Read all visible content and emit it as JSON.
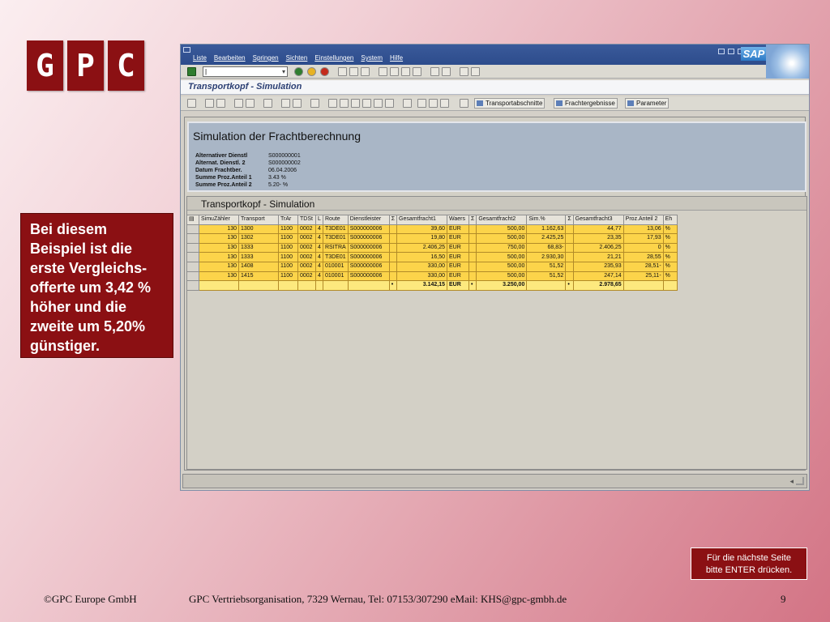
{
  "logo": {
    "letters": [
      "G",
      "P",
      "C"
    ]
  },
  "callout": "Bei diesem Beispiel ist die erste Vergleichs-offerte um 3,42 % höher und die zweite um 5,20% günstiger.",
  "enter_hint": [
    "Für die nächste Seite",
    "bitte ENTER drücken."
  ],
  "footer": {
    "copyright": "©GPC Europe GmbH",
    "contact": "GPC Vertriebsorganisation, 7329 Wernau, Tel: 07153/307290   eMail: KHS@gpc-gmbh.de",
    "page": "9"
  },
  "sap": {
    "menu": [
      "Liste",
      "Bearbeiten",
      "Springen",
      "Sichten",
      "Einstellungen",
      "System",
      "Hilfe"
    ],
    "logo": "SAP",
    "title": "Transportkopf - Simulation",
    "toolbar_buttons": [
      "Transportabschnitte",
      "Frachtergebnisse",
      "Parameter"
    ],
    "header_panel": {
      "title": "Simulation der Frachtberechnung",
      "rows": [
        {
          "label": "Alternativer Dienstl",
          "value": "S000000001"
        },
        {
          "label": "Alternat. Dienstl. 2",
          "value": "S000000002"
        },
        {
          "label": "Datum Frachtber.",
          "value": "06.04.2006"
        },
        {
          "label": "Summe Proz.Anteil 1",
          "value": "3.43 %"
        },
        {
          "label": "Summe Proz.Anteil 2",
          "value": "5.20- %"
        }
      ]
    },
    "list_title": "Transportkopf - Simulation",
    "columns": [
      "SimuZähler",
      "Transport",
      "TrAr",
      "TDSt",
      "L",
      "Route",
      "Dienstleister",
      "Σ",
      "Gesamtfracht1",
      "Waers",
      "Σ",
      "Gesamtfracht2",
      "Sim.%",
      "Σ",
      "Gesamtfracht3",
      "Proz.Anteil 2",
      "Eh"
    ],
    "rows": [
      [
        "130",
        "1300",
        "1100",
        "0002",
        "4",
        "T3DE01",
        "S000000006",
        "",
        "39,60",
        "EUR",
        "",
        "500,00",
        "1.162,63",
        "",
        "44,77",
        "13,06",
        "%"
      ],
      [
        "130",
        "1302",
        "1100",
        "0002",
        "4",
        "T3DE01",
        "S000000006",
        "",
        "19,80",
        "EUR",
        "",
        "500,00",
        "2.425,25",
        "",
        "23,35",
        "17,93",
        "%"
      ],
      [
        "130",
        "1333",
        "1100",
        "0002",
        "4",
        "RSITRA",
        "S000000006",
        "",
        "2.406,25",
        "EUR",
        "",
        "750,00",
        "68,83-",
        "",
        "2.406,25",
        "0",
        "%"
      ],
      [
        "130",
        "1333",
        "1100",
        "0002",
        "4",
        "T3DE01",
        "S000000006",
        "",
        "16,50",
        "EUR",
        "",
        "500,00",
        "2.930,30",
        "",
        "21,21",
        "28,55",
        "%"
      ],
      [
        "130",
        "1408",
        "1100",
        "0002",
        "4",
        "010001",
        "S000000006",
        "",
        "330,00",
        "EUR",
        "",
        "500,00",
        "51,52",
        "",
        "235,93",
        "28,51-",
        "%"
      ],
      [
        "130",
        "1415",
        "1100",
        "0002",
        "4",
        "010001",
        "S000000006",
        "",
        "330,00",
        "EUR",
        "",
        "500,00",
        "51,52",
        "",
        "247,14",
        "25,11-",
        "%"
      ]
    ],
    "sum_row": [
      "",
      "",
      "",
      "",
      "",
      "",
      "",
      "•",
      "3.142,15",
      "EUR",
      "•",
      "3.250,00",
      "",
      "•",
      "2.978,65",
      "",
      ""
    ]
  }
}
